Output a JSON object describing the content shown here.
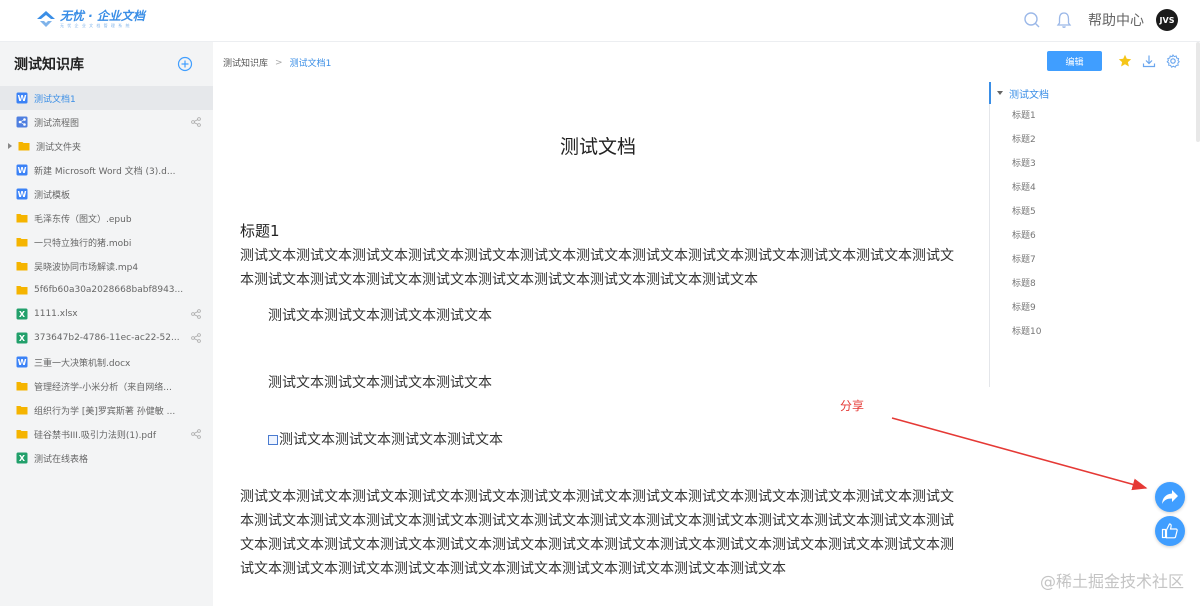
{
  "app": {
    "logo_title": "无忧 · 企业文档",
    "logo_sub": "无 忧 企 业 文 档 管 理 系 统",
    "help_label": "帮助中心",
    "avatar_text": "JVS"
  },
  "sidebar": {
    "title": "测试知识库",
    "items": [
      {
        "label": "测试文档1",
        "type": "word",
        "active": true,
        "shared": false
      },
      {
        "label": "测试流程图",
        "type": "flow",
        "active": false,
        "shared": true
      },
      {
        "label": "测试文件夹",
        "type": "folder",
        "active": false,
        "shared": false
      },
      {
        "label": "新建 Microsoft Word 文档 (3).d...",
        "type": "word",
        "active": false,
        "shared": false
      },
      {
        "label": "测试模板",
        "type": "word",
        "active": false,
        "shared": false
      },
      {
        "label": "毛泽东传（图文）.epub",
        "type": "file",
        "active": false,
        "shared": false
      },
      {
        "label": "一只特立独行的猪.mobi",
        "type": "file",
        "active": false,
        "shared": false
      },
      {
        "label": "吴晓波协同市场解读.mp4",
        "type": "file",
        "active": false,
        "shared": false
      },
      {
        "label": "5f6fb60a30a2028668babf8943...",
        "type": "file",
        "active": false,
        "shared": false
      },
      {
        "label": "1111.xlsx",
        "type": "excel",
        "active": false,
        "shared": true
      },
      {
        "label": "373647b2-4786-11ec-ac22-52...",
        "type": "excel",
        "active": false,
        "shared": true
      },
      {
        "label": "三重一大决策机制.docx",
        "type": "word",
        "active": false,
        "shared": false
      },
      {
        "label": "管理经济学-小米分析（来自网络...",
        "type": "file",
        "active": false,
        "shared": false
      },
      {
        "label": "组织行为学 [美]罗宾斯著 孙健敏 ...",
        "type": "file",
        "active": false,
        "shared": false
      },
      {
        "label": "硅谷禁书III.吸引力法则(1).pdf",
        "type": "file",
        "active": false,
        "shared": true
      },
      {
        "label": "测试在线表格",
        "type": "excel",
        "active": false,
        "shared": false
      }
    ]
  },
  "breadcrumb": {
    "root": "测试知识库",
    "sep": ">",
    "current": "测试文档1"
  },
  "toolbar": {
    "edit_label": "编辑"
  },
  "document": {
    "title": "测试文档",
    "heading1": "标题1",
    "para1": "测试文本测试文本测试文本测试文本测试文本测试文本测试文本测试文本测试文本测试文本测试文本测试文本测试文本测试文本测试文本测试文本测试文本测试文本测试文本测试文本测试文本测试文本",
    "indent1": "测试文本测试文本测试文本测试文本",
    "indent2": "测试文本测试文本测试文本测试文本",
    "indent3": "测试文本测试文本测试文本测试文本",
    "para2": "测试文本测试文本测试文本测试文本测试文本测试文本测试文本测试文本测试文本测试文本测试文本测试文本测试文本测试文本测试文本测试文本测试文本测试文本测试文本测试文本测试文本测试文本测试文本测试文本测试文本测试文本测试文本测试文本测试文本测试文本测试文本测试文本测试文本测试文本测试文本测试文本测试文本测试文本测试文本测试文本测试文本测试文本测试文本测试文本测试文本测试文本测试文本测试文本"
  },
  "toc": {
    "root": "测试文档",
    "items": [
      "标题1",
      "标题2",
      "标题3",
      "标题4",
      "标题5",
      "标题6",
      "标题7",
      "标题8",
      "标题9",
      "标题10"
    ]
  },
  "annotation": {
    "label": "分享"
  },
  "watermark": "@稀土掘金技术社区",
  "colors": {
    "accent": "#409eff",
    "annotation": "#e53935",
    "word": "#3b82f6",
    "excel": "#22a06b",
    "folder": "#f5b400"
  }
}
